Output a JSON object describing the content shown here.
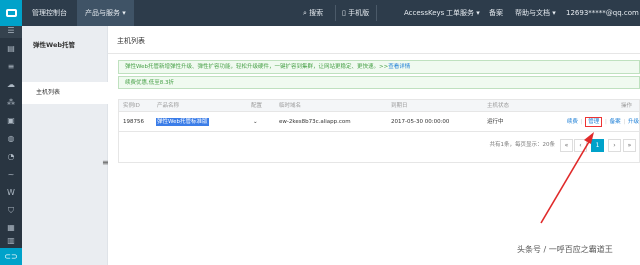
{
  "topbar": {
    "console": "管理控制台",
    "products": "产品与服务 ▾",
    "search": "搜索",
    "mobile": "手机版",
    "accesskeys": "AccessKeys",
    "orders": "工单服务 ▾",
    "beian": "备案",
    "help": "帮助与文档 ▾",
    "account": "12693*****@qq.com ▾",
    "colors": {
      "bg": "#2d3c4b",
      "logo": "#00a2ca"
    }
  },
  "iconbar": {
    "icons": [
      "menu-icon",
      "server-icon",
      "list-icon",
      "cloud-icon",
      "network-icon",
      "database-icon",
      "globe-icon",
      "chart-icon",
      "wave-icon",
      "monitor-icon",
      "shield-icon",
      "box-icon",
      "building-icon",
      "logo-icon"
    ]
  },
  "subnav": {
    "title": "弹性Web托管",
    "item": "主机列表"
  },
  "main": {
    "title": "主机列表",
    "notice1": {
      "text": "弹性Web托管新增弹性升级、弹性扩容功能，轻松升级硬件，一键扩容到集群，让网站更稳定、更快速。>>",
      "link": "查看详情"
    },
    "notice2": "续费优惠,低至8.3折",
    "table": {
      "headers": [
        "实例ID",
        "产品名称",
        "配置",
        "临时域名",
        "到期日",
        "主机状态",
        "操作"
      ],
      "rows": [
        {
          "id": "198756",
          "name": "弹性Web托管标准版",
          "config": "⌄",
          "domain": "ew-2kes8b73c.aliapp.com",
          "expire": "2017-05-30 00:00:00",
          "status": "运行中",
          "ops": [
            "续费",
            "管理",
            "备案",
            "升级"
          ]
        }
      ],
      "pager": {
        "text": "共有1条，每页显示：20条",
        "first": "«",
        "prev": "‹",
        "current": "1",
        "next": "›",
        "last": "»"
      }
    }
  },
  "watermark": "头条号 / 一呼百应之霸道王"
}
